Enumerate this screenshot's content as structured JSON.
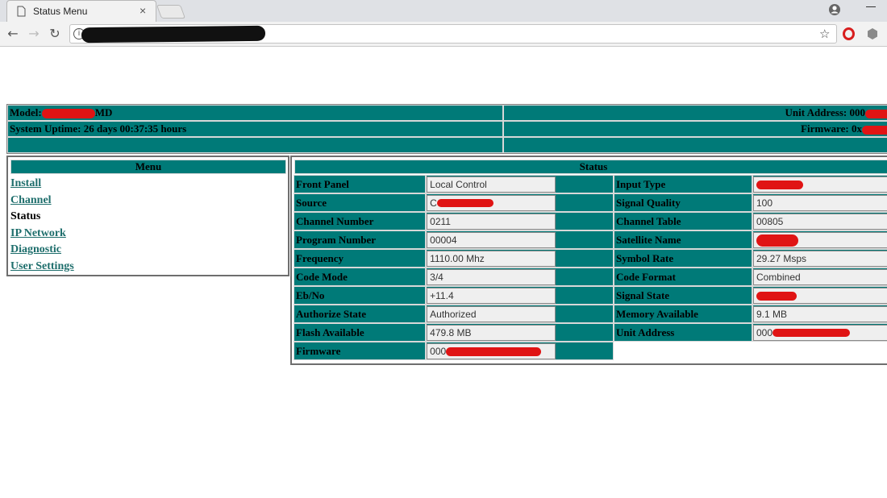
{
  "browser": {
    "tab_title": "Status Menu",
    "tab_close": "×",
    "info_glyph": "i",
    "nav": {
      "back": "←",
      "forward": "→",
      "reload": "↻"
    },
    "star": "☆"
  },
  "header": {
    "model_prefix": "Model:",
    "model_suffix": "MD",
    "unit_address_label": "Unit Address: 000",
    "uptime": "System Uptime: 26 days 00:37:35 hours",
    "firmware_label": "Firmware: 0x"
  },
  "menu": {
    "title": "Menu",
    "items": [
      {
        "label": "Install",
        "link": true
      },
      {
        "label": "Channel",
        "link": true
      },
      {
        "label": "Status",
        "link": false
      },
      {
        "label": "IP Network",
        "link": true
      },
      {
        "label": "Diagnostic",
        "link": true
      },
      {
        "label": "User Settings",
        "link": true
      }
    ]
  },
  "status": {
    "title": "Status",
    "rows": [
      {
        "l1": "Front Panel",
        "v1": "Local Control",
        "l2": "Input Type",
        "v2": ""
      },
      {
        "l1": "Source",
        "v1": "C",
        "l2": "Signal Quality",
        "v2": "100"
      },
      {
        "l1": "Channel Number",
        "v1": "0211",
        "l2": "Channel Table",
        "v2": "00805"
      },
      {
        "l1": "Program Number",
        "v1": "00004",
        "l2": "Satellite Name",
        "v2": ""
      },
      {
        "l1": "Frequency",
        "v1": "1110.00 Mhz",
        "l2": "Symbol Rate",
        "v2": "29.27 Msps"
      },
      {
        "l1": "Code Mode",
        "v1": "3/4",
        "l2": "Code Format",
        "v2": "Combined"
      },
      {
        "l1": "Eb/No",
        "v1": "+11.4",
        "l2": "Signal State",
        "v2": ""
      },
      {
        "l1": "Authorize State",
        "v1": "Authorized",
        "l2": "Memory Available",
        "v2": "9.1 MB"
      },
      {
        "l1": "Flash Available",
        "v1": "479.8 MB",
        "l2": "Unit Address",
        "v2": "000"
      },
      {
        "l1": "Firmware",
        "v1": "000"
      }
    ]
  },
  "colors": {
    "teal": "#007a78",
    "link": "#1e6e6c",
    "redaction": "#e01414"
  }
}
